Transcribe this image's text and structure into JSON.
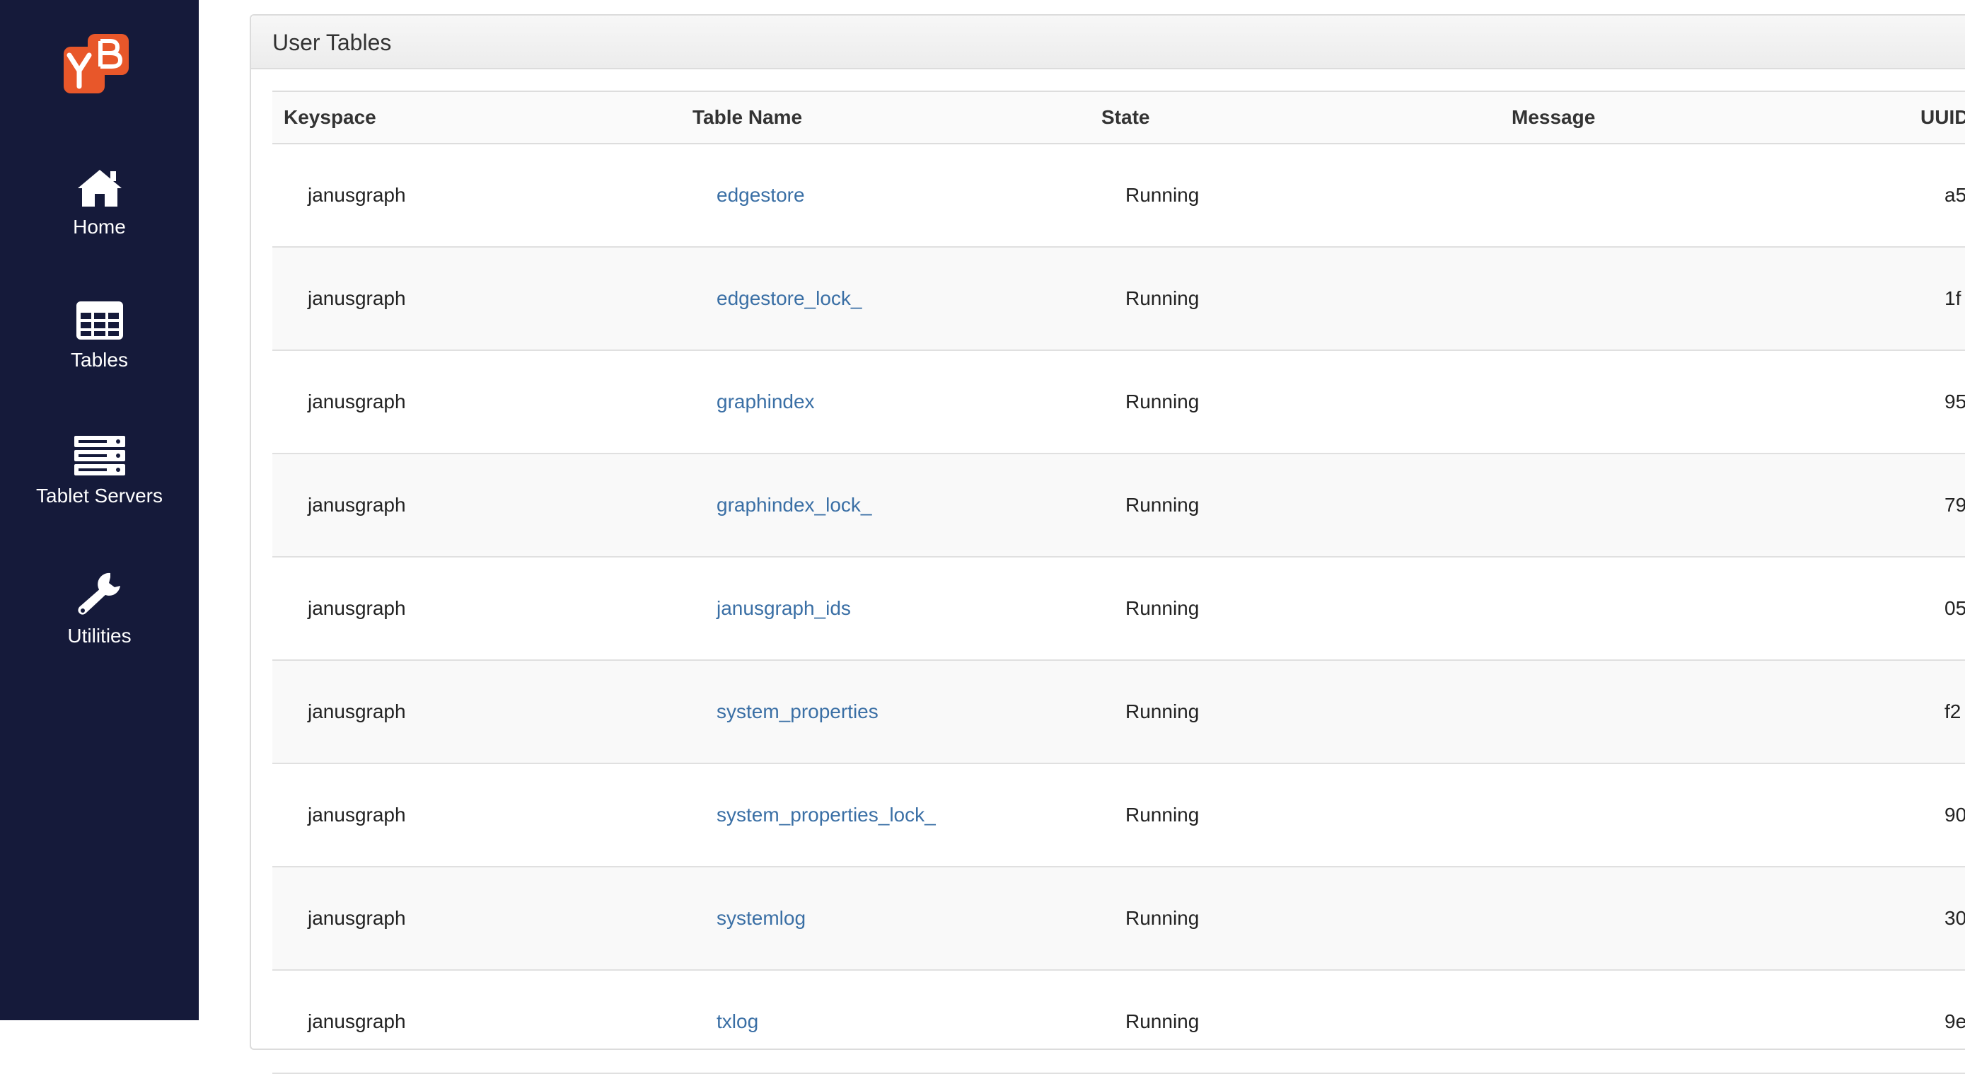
{
  "sidebar": {
    "logo_text": "YB",
    "items": [
      {
        "label": "Home",
        "icon": "home-icon"
      },
      {
        "label": "Tables",
        "icon": "table-icon"
      },
      {
        "label": "Tablet Servers",
        "icon": "server-icon"
      },
      {
        "label": "Utilities",
        "icon": "wrench-icon"
      }
    ]
  },
  "panel": {
    "title": "User Tables",
    "columns": [
      "Keyspace",
      "Table Name",
      "State",
      "Message",
      "UUID"
    ],
    "rows": [
      {
        "keyspace": "janusgraph",
        "table_name": "edgestore",
        "state": "Running",
        "message": "",
        "uuid": "a5"
      },
      {
        "keyspace": "janusgraph",
        "table_name": "edgestore_lock_",
        "state": "Running",
        "message": "",
        "uuid": "1f"
      },
      {
        "keyspace": "janusgraph",
        "table_name": "graphindex",
        "state": "Running",
        "message": "",
        "uuid": "95"
      },
      {
        "keyspace": "janusgraph",
        "table_name": "graphindex_lock_",
        "state": "Running",
        "message": "",
        "uuid": "79"
      },
      {
        "keyspace": "janusgraph",
        "table_name": "janusgraph_ids",
        "state": "Running",
        "message": "",
        "uuid": "05"
      },
      {
        "keyspace": "janusgraph",
        "table_name": "system_properties",
        "state": "Running",
        "message": "",
        "uuid": "f2"
      },
      {
        "keyspace": "janusgraph",
        "table_name": "system_properties_lock_",
        "state": "Running",
        "message": "",
        "uuid": "90"
      },
      {
        "keyspace": "janusgraph",
        "table_name": "systemlog",
        "state": "Running",
        "message": "",
        "uuid": "30"
      },
      {
        "keyspace": "janusgraph",
        "table_name": "txlog",
        "state": "Running",
        "message": "",
        "uuid": "9e"
      }
    ]
  },
  "colors": {
    "sidebar_bg": "#151a3a",
    "logo_orange": "#e8572a",
    "link_blue": "#3a6fa5"
  }
}
